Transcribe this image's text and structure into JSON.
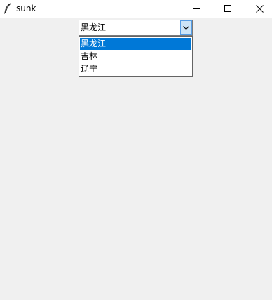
{
  "window": {
    "title": "sunk",
    "app_icon": "feather-icon",
    "controls": [
      "minimize-icon",
      "maximize-icon",
      "close-icon"
    ]
  },
  "combobox": {
    "value": "黑龙江",
    "arrow_icon": "chevron-down-icon",
    "options": [
      {
        "label": "黑龙江",
        "selected": true
      },
      {
        "label": "吉林",
        "selected": false
      },
      {
        "label": "辽宁",
        "selected": false
      }
    ]
  },
  "colors": {
    "selection": "#0078d7",
    "arrow_button_bg": "#cce4f7",
    "arrow_button_border": "#569de5",
    "window_bg": "#f0f0f0"
  }
}
